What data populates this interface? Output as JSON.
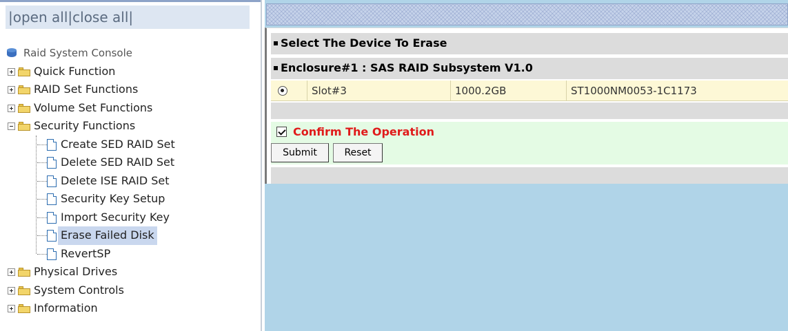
{
  "tree_header": {
    "open_all": "open all",
    "close_all": "close all",
    "separator": "|"
  },
  "tree": {
    "root": "Raid System Console",
    "groups": [
      {
        "label": "Quick Function",
        "expanded": false
      },
      {
        "label": "RAID Set Functions",
        "expanded": false
      },
      {
        "label": "Volume Set Functions",
        "expanded": false
      },
      {
        "label": "Security Functions",
        "expanded": true,
        "children": [
          "Create SED RAID Set",
          "Delete SED RAID Set",
          "Delete ISE RAID Set",
          "Security Key Setup",
          "Import Security Key",
          "Erase Failed Disk",
          "RevertSP"
        ],
        "selected_child": "Erase Failed Disk"
      },
      {
        "label": "Physical Drives",
        "expanded": false
      },
      {
        "label": "System Controls",
        "expanded": false
      },
      {
        "label": "Information",
        "expanded": false
      }
    ]
  },
  "main": {
    "section_title": "Select The Device To Erase",
    "enclosure_title": "Enclosure#1 : SAS RAID Subsystem V1.0",
    "drive": {
      "slot": "Slot#3",
      "capacity": "1000.2GB",
      "model": "ST1000NM0053-1C1173",
      "selected": true
    },
    "confirm": {
      "label": "Confirm The Operation",
      "checked": true
    },
    "buttons": {
      "submit": "Submit",
      "reset": "Reset"
    }
  },
  "colors": {
    "tree_header_bg": "#dde6f2",
    "right_bg": "#b0d4e8",
    "band_gray": "#dcdcdc",
    "drive_row_bg": "#fdf8d6",
    "confirm_bg": "#e4fbe4",
    "confirm_text": "#e01a1a",
    "selected_item_bg": "#c9d7ee"
  }
}
